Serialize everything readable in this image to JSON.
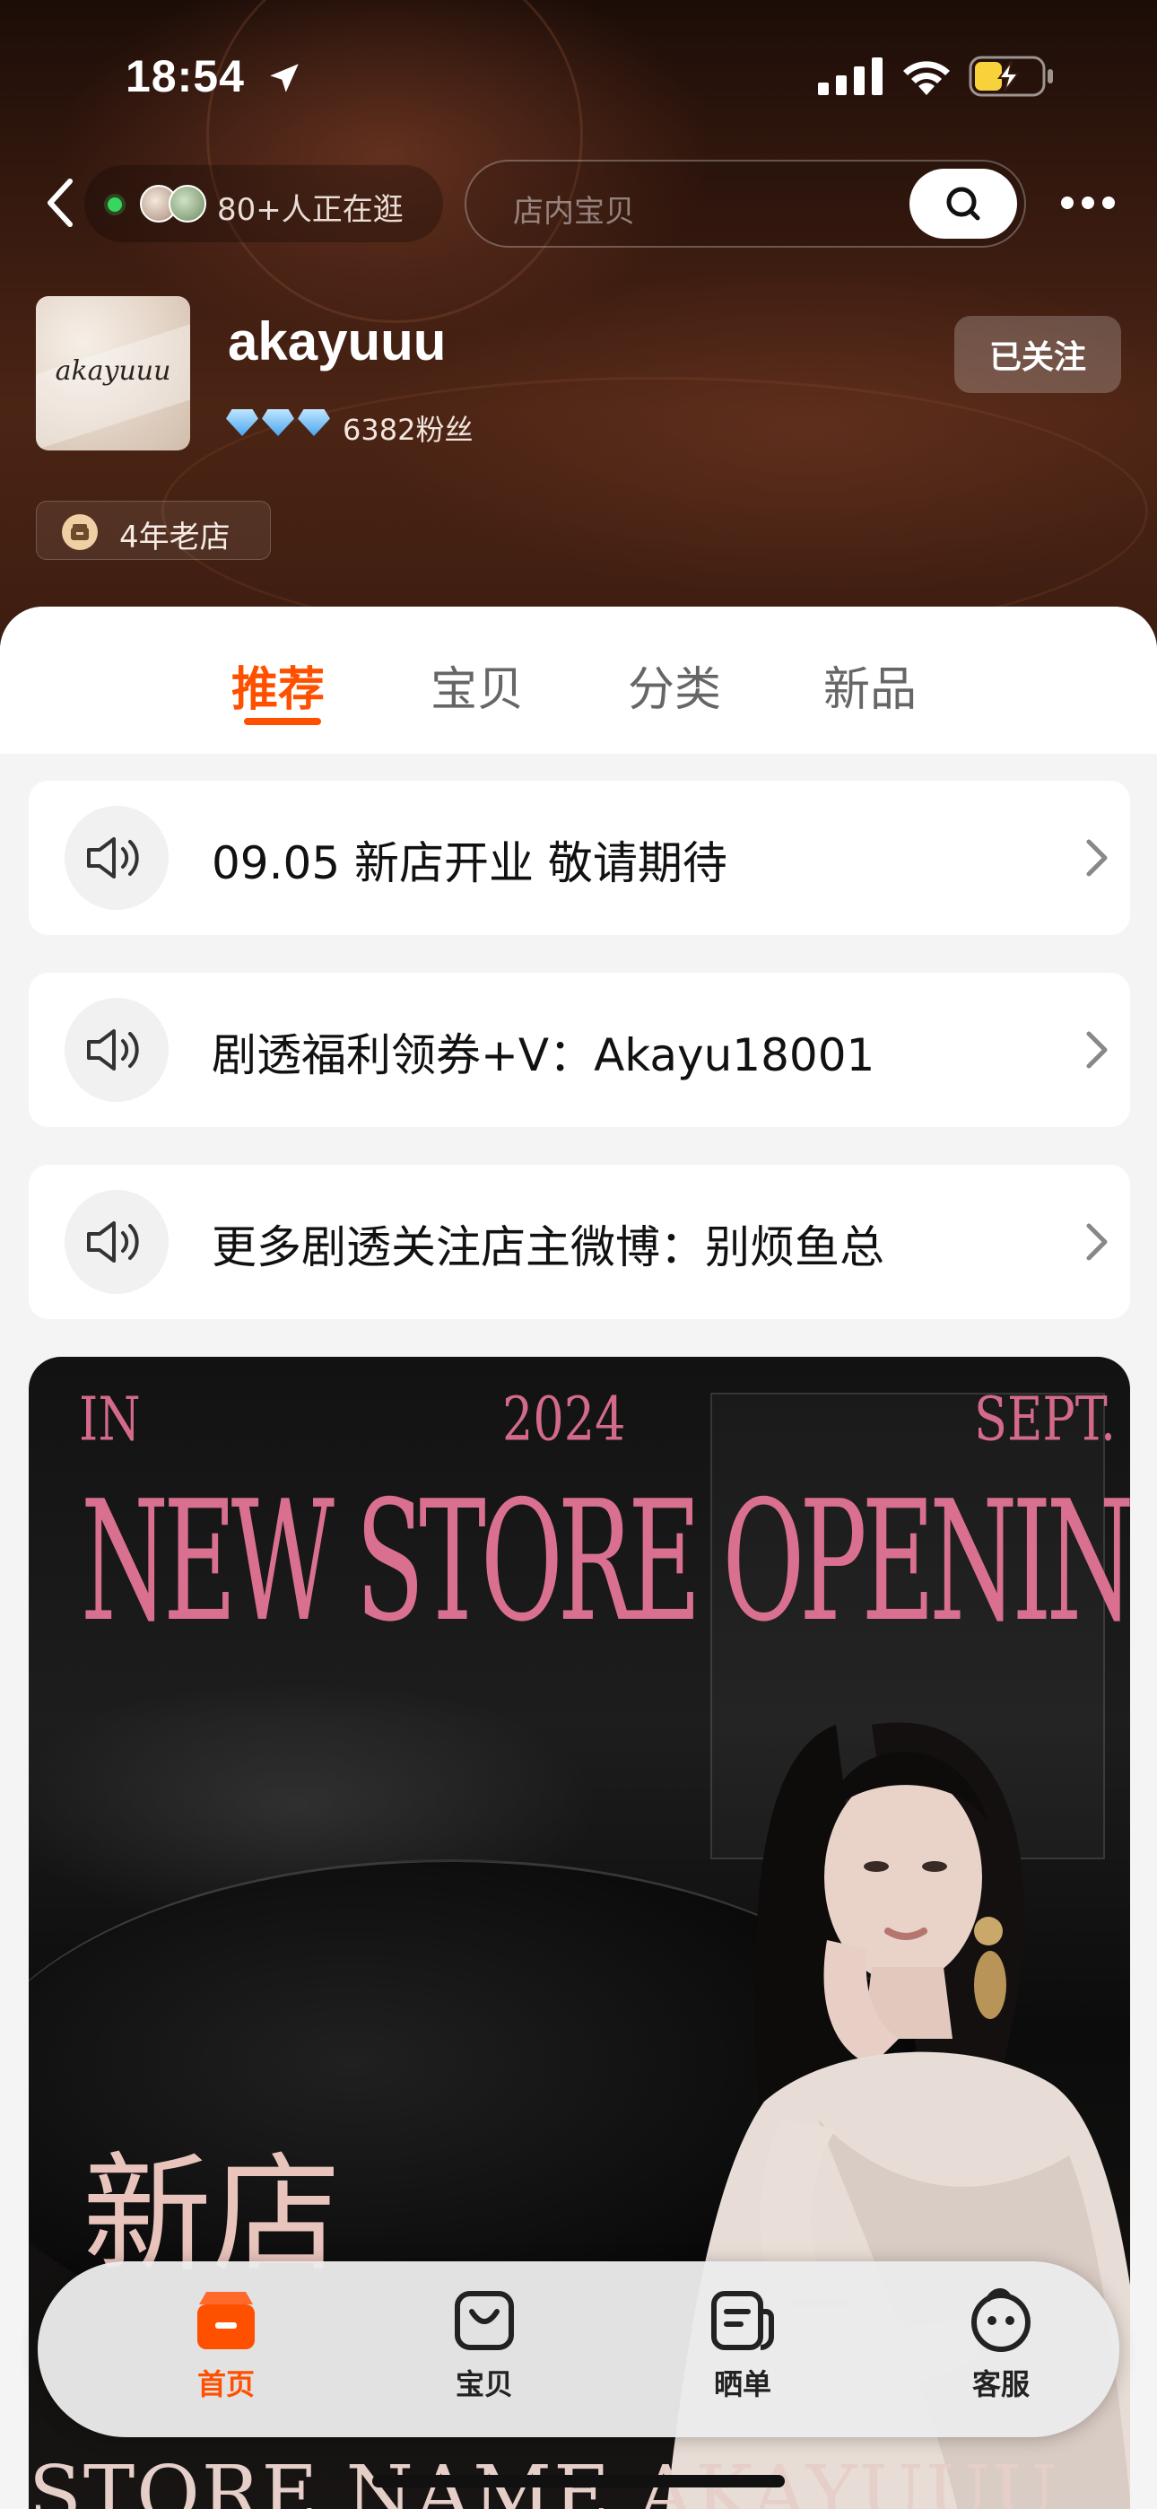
{
  "status_bar": {
    "time": "18:54"
  },
  "nav": {
    "visitors_text": "80+人正在逛",
    "search_placeholder": "店内宝贝"
  },
  "shop": {
    "logo_text": "akayuuu",
    "name": "akayuuu",
    "fans": "6382粉丝",
    "follow_label": "已关注",
    "store_age": "4年老店"
  },
  "tabs": [
    {
      "label": "推荐",
      "active": true
    },
    {
      "label": "宝贝"
    },
    {
      "label": "分类"
    },
    {
      "label": "新品"
    }
  ],
  "notices": [
    {
      "text": "09.05 新店开业 敬请期待"
    },
    {
      "text": "剧透福利领券+V：Akayu18001"
    },
    {
      "text": "更多剧透关注店主微博：别烦鱼总"
    }
  ],
  "banner": {
    "left_tag": "IN",
    "year": "2024",
    "month": "SEPT.",
    "headline": "NEW STORE OPENING",
    "chinese": "新店",
    "bottom_text": "STORE NAME  AKAYUUU"
  },
  "tabbar": [
    {
      "label": "首页",
      "icon": "shop-home-icon",
      "active": true
    },
    {
      "label": "宝贝",
      "icon": "shopping-bag-icon"
    },
    {
      "label": "晒单",
      "icon": "review-card-icon"
    },
    {
      "label": "客服",
      "icon": "customer-service-icon"
    }
  ],
  "colors": {
    "accent": "#ff5000",
    "banner_pink": "#d9708f"
  }
}
